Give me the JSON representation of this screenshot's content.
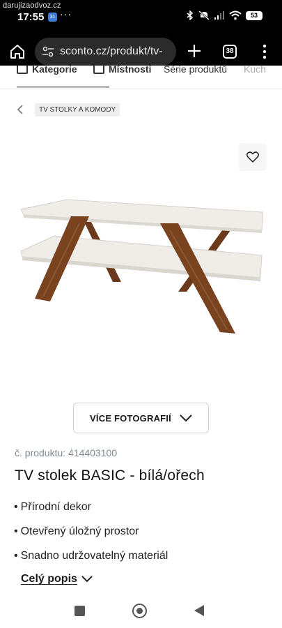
{
  "status_bar": {
    "watermark": "darujizaodvoz.cz",
    "time": "17:55",
    "app_badge": "31",
    "more": "···",
    "battery": "53"
  },
  "browser": {
    "url": "sconto.cz/produkt/tv-",
    "tab_count": "38"
  },
  "categories": {
    "items": [
      "Kategorie",
      "Místnosti",
      "Série produktů",
      "Kuch"
    ]
  },
  "breadcrumb": {
    "label": "TV STOLKY A KOMODY"
  },
  "gallery": {
    "more_photos_label": "VÍCE FOTOGRAFIÍ"
  },
  "product": {
    "sku": "č. produktu: 414403100",
    "title": "TV stolek BASIC - bílá/ořech",
    "features": [
      "Přírodní dekor",
      "Otevřený úložný prostor",
      "Snadno udržovatelný materiál"
    ],
    "full_description_label": "Celý popis"
  },
  "colors": {
    "wood": "#7a4320",
    "board": "#f0ede8"
  }
}
